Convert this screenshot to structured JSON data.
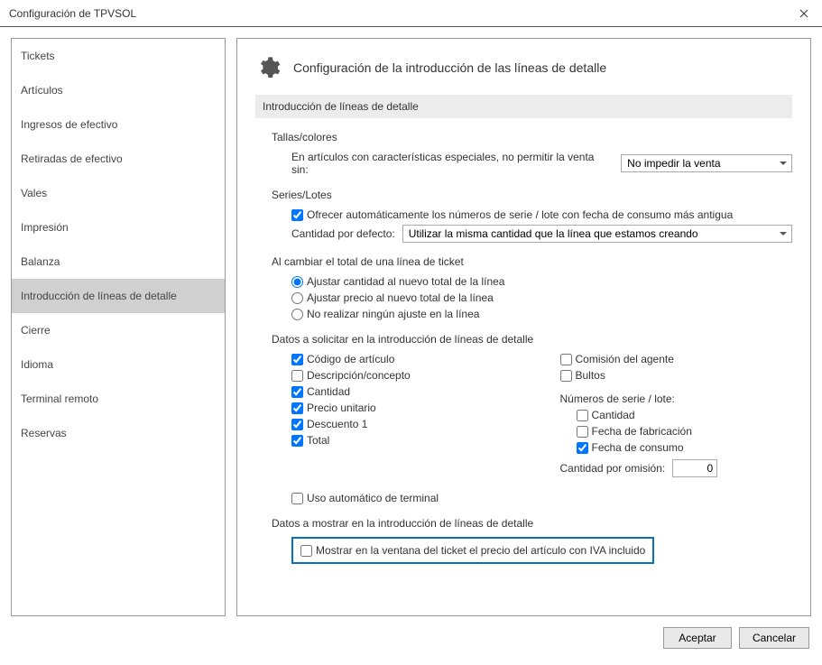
{
  "window": {
    "title": "Configuración de TPVSOL"
  },
  "sidebar": {
    "items": [
      {
        "label": "Tickets"
      },
      {
        "label": "Artículos"
      },
      {
        "label": "Ingresos de efectivo"
      },
      {
        "label": "Retiradas de efectivo"
      },
      {
        "label": "Vales"
      },
      {
        "label": "Impresión"
      },
      {
        "label": "Balanza"
      },
      {
        "label": "Introducción de líneas de detalle"
      },
      {
        "label": "Cierre"
      },
      {
        "label": "Idioma"
      },
      {
        "label": "Terminal remoto"
      },
      {
        "label": "Reservas"
      }
    ]
  },
  "main": {
    "title": "Configuración de la introducción de las líneas de detalle",
    "section": "Introducción de líneas de detalle",
    "tallas": {
      "label": "Tallas/colores",
      "text": "En artículos con características especiales, no permitir la venta sin:",
      "select": "No impedir la venta"
    },
    "series": {
      "label": "Series/Lotes",
      "check": "Ofrecer automáticamente los números de serie / lote con fecha de consumo más antigua",
      "qty_label": "Cantidad por defecto:",
      "qty_select": "Utilizar la misma cantidad que la línea que estamos creando"
    },
    "cambio": {
      "label": "Al cambiar el total de una línea de ticket",
      "r1": "Ajustar cantidad al nuevo total de la línea",
      "r2": "Ajustar precio al nuevo total de la línea",
      "r3": "No realizar ningún ajuste en la línea"
    },
    "datos_solicitar": {
      "label": "Datos a solicitar en la introducción de líneas de detalle",
      "left": {
        "codigo": "Código de artículo",
        "desc": "Descripción/concepto",
        "cantidad": "Cantidad",
        "precio": "Precio unitario",
        "desc1": "Descuento 1",
        "total": "Total"
      },
      "right": {
        "comision": "Comisión del agente",
        "bultos": "Bultos",
        "series_label": "Números de serie / lote:",
        "cantidad": "Cantidad",
        "fab": "Fecha de fabricación",
        "consumo": "Fecha de consumo",
        "omision_label": "Cantidad por omisión:",
        "omision_val": "0"
      },
      "auto": "Uso automático de terminal"
    },
    "datos_mostrar": {
      "label": "Datos a mostrar en la introducción de líneas de detalle",
      "iva": "Mostrar en la ventana del ticket el precio del artículo con IVA incluido"
    }
  },
  "footer": {
    "ok": "Aceptar",
    "cancel": "Cancelar"
  }
}
